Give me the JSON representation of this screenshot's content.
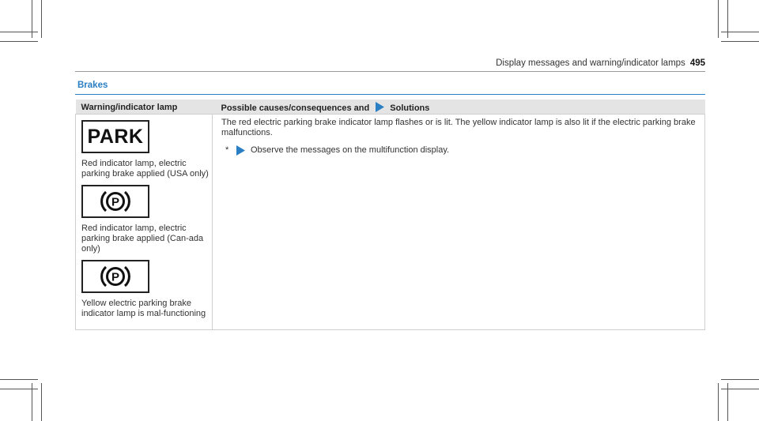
{
  "header": {
    "running_title": "Display messages and warning/indicator lamps",
    "page_number": "495"
  },
  "section": {
    "title": "Brakes"
  },
  "table": {
    "columns": [
      "Warning/indicator lamp",
      "Possible causes/consequences and",
      "Solutions"
    ],
    "lamps": [
      {
        "icon": "park-lamp-icon",
        "symbol": "PARK",
        "caption": "Red indicator lamp, electric parking brake applied (USA only)"
      },
      {
        "icon": "parking-brake-p-icon",
        "caption": "Red indicator lamp, electric parking brake applied (Can-ada only)"
      },
      {
        "icon": "parking-brake-p-icon",
        "caption": "Yellow electric parking brake indicator lamp is mal-functioning"
      }
    ],
    "causes_text": "The red electric parking brake indicator lamp flashes or is lit. The yellow indicator lamp is also lit if the electric parking brake malfunctions.",
    "solution": {
      "marker": "*",
      "text": "Observe the messages on the multifunction display."
    }
  },
  "colors": {
    "accent": "#2a7fc4",
    "header_bg": "#e4e4e4"
  }
}
